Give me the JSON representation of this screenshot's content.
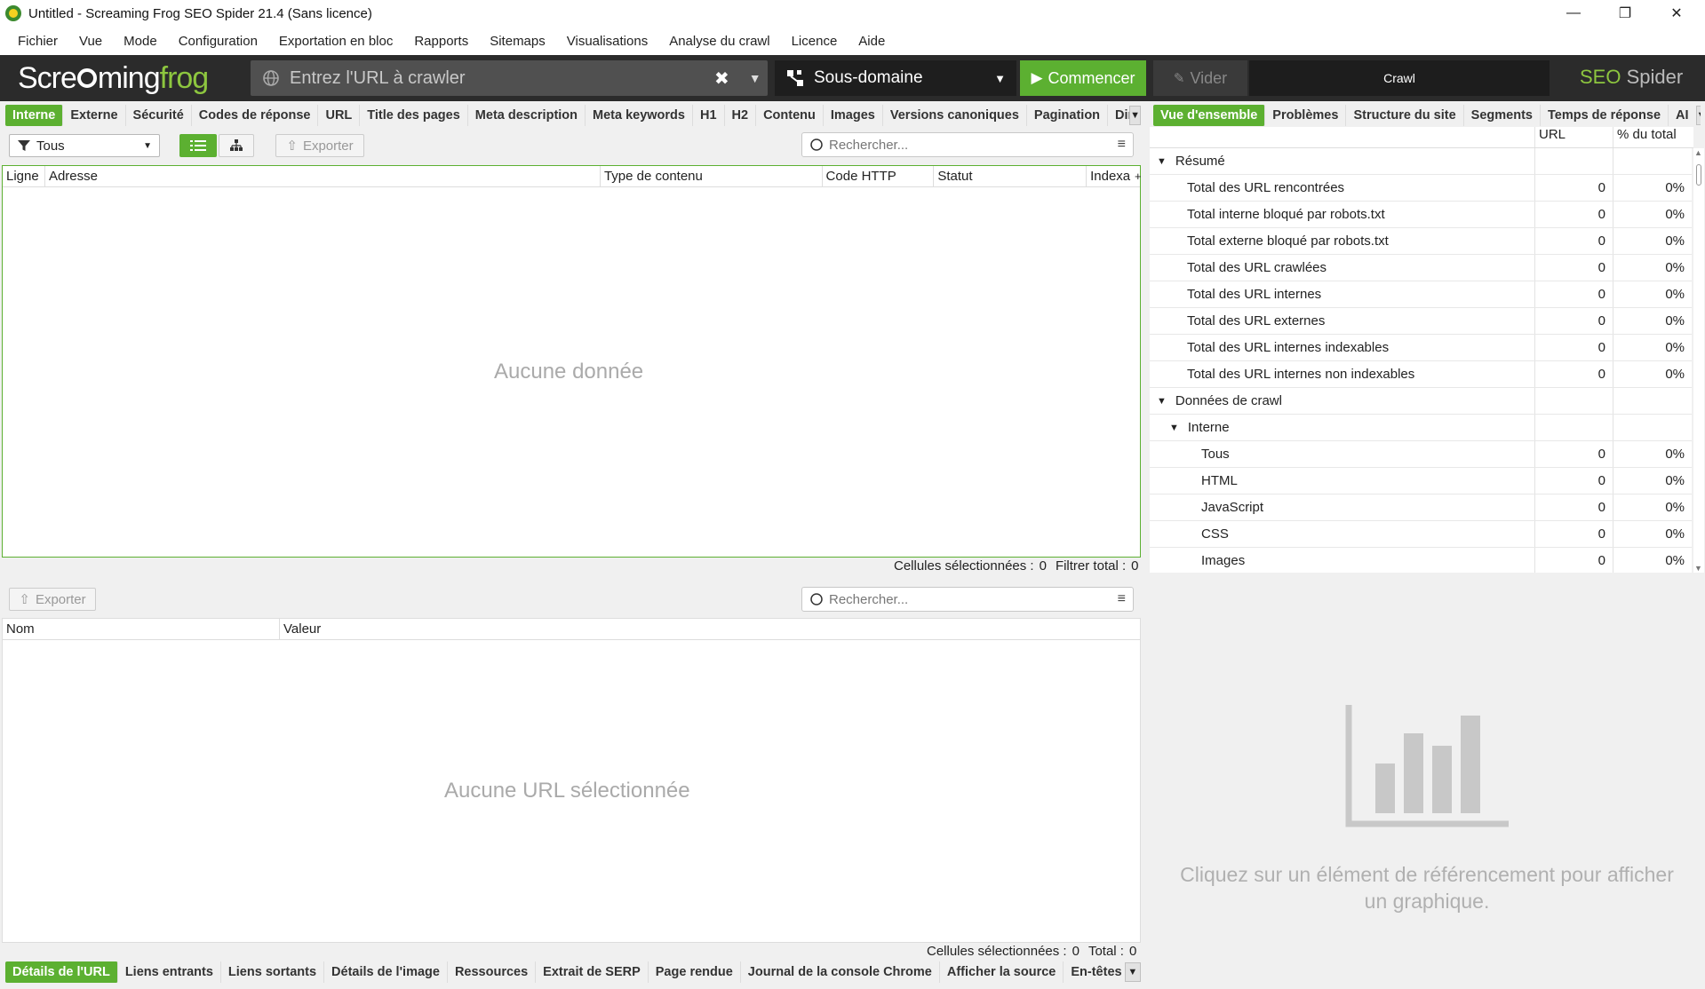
{
  "window": {
    "title": "Untitled - Screaming Frog SEO Spider 21.4 (Sans licence)"
  },
  "menu": [
    "Fichier",
    "Vue",
    "Mode",
    "Configuration",
    "Exportation en bloc",
    "Rapports",
    "Sitemaps",
    "Visualisations",
    "Analyse du crawl",
    "Licence",
    "Aide"
  ],
  "toolbar": {
    "logo_a": "Scre",
    "logo_b": "ming",
    "logo_c": "frog",
    "url_placeholder": "Entrez l'URL à crawler",
    "mode": "Sous-domaine",
    "start": "Commencer",
    "clear": "Vider",
    "crawl": "Crawl",
    "brand_a": "SEO",
    "brand_b": " Spider"
  },
  "top_tabs": [
    "Interne",
    "Externe",
    "Sécurité",
    "Codes de réponse",
    "URL",
    "Title des pages",
    "Meta description",
    "Meta keywords",
    "H1",
    "H2",
    "Contenu",
    "Images",
    "Versions canoniques",
    "Pagination",
    "Dire"
  ],
  "right_tabs": [
    "Vue d'ensemble",
    "Problèmes",
    "Structure du site",
    "Segments",
    "Temps de réponse",
    "AI"
  ],
  "filter": {
    "label": "Tous"
  },
  "export": "Exporter",
  "search_placeholder": "Rechercher...",
  "main_table": {
    "columns": [
      "Ligne",
      "Adresse",
      "Type de contenu",
      "Code HTTP",
      "Statut",
      "Indexa"
    ],
    "empty": "Aucune donnée",
    "status_sel_label": "Cellules sélectionnées :",
    "status_sel": "0",
    "status_total_label": "Filtrer total :",
    "status_total": "0"
  },
  "detail_table": {
    "columns": [
      "Nom",
      "Valeur"
    ],
    "empty": "Aucune URL sélectionnée",
    "status_sel_label": "Cellules sélectionnées :",
    "status_sel": "0",
    "status_total_label": "Total :",
    "status_total": "0"
  },
  "bottom_tabs": [
    "Détails de l'URL",
    "Liens entrants",
    "Liens sortants",
    "Détails de l'image",
    "Ressources",
    "Extrait de SERP",
    "Page rendue",
    "Journal de la console Chrome",
    "Afficher la source",
    "En-têtes HT"
  ],
  "overview": {
    "col_url": "URL",
    "col_pct": "% du total",
    "rows": [
      {
        "label": "Résumé",
        "level": 0,
        "expanded": true,
        "num": "",
        "pct": ""
      },
      {
        "label": "Total des URL rencontrées",
        "level": 1,
        "num": "0",
        "pct": "0%"
      },
      {
        "label": "Total interne bloqué par robots.txt",
        "level": 1,
        "num": "0",
        "pct": "0%"
      },
      {
        "label": "Total externe bloqué par robots.txt",
        "level": 1,
        "num": "0",
        "pct": "0%"
      },
      {
        "label": "Total des URL crawlées",
        "level": 1,
        "num": "0",
        "pct": "0%"
      },
      {
        "label": "Total des URL internes",
        "level": 1,
        "num": "0",
        "pct": "0%"
      },
      {
        "label": "Total des URL externes",
        "level": 1,
        "num": "0",
        "pct": "0%"
      },
      {
        "label": "Total des URL internes indexables",
        "level": 1,
        "num": "0",
        "pct": "0%"
      },
      {
        "label": "Total des URL internes non indexables",
        "level": 1,
        "num": "0",
        "pct": "0%"
      },
      {
        "label": "Données de crawl",
        "level": 0,
        "expanded": true,
        "num": "",
        "pct": ""
      },
      {
        "label": "Interne",
        "level": 1,
        "expanded": true,
        "num": "",
        "pct": ""
      },
      {
        "label": "Tous",
        "level": 2,
        "num": "0",
        "pct": "0%"
      },
      {
        "label": "HTML",
        "level": 2,
        "num": "0",
        "pct": "0%"
      },
      {
        "label": "JavaScript",
        "level": 2,
        "num": "0",
        "pct": "0%"
      },
      {
        "label": "CSS",
        "level": 2,
        "num": "0",
        "pct": "0%"
      },
      {
        "label": "Images",
        "level": 2,
        "num": "0",
        "pct": "0%"
      }
    ]
  },
  "graph_hint": "Cliquez sur un élément de référencement pour afficher un graphique."
}
